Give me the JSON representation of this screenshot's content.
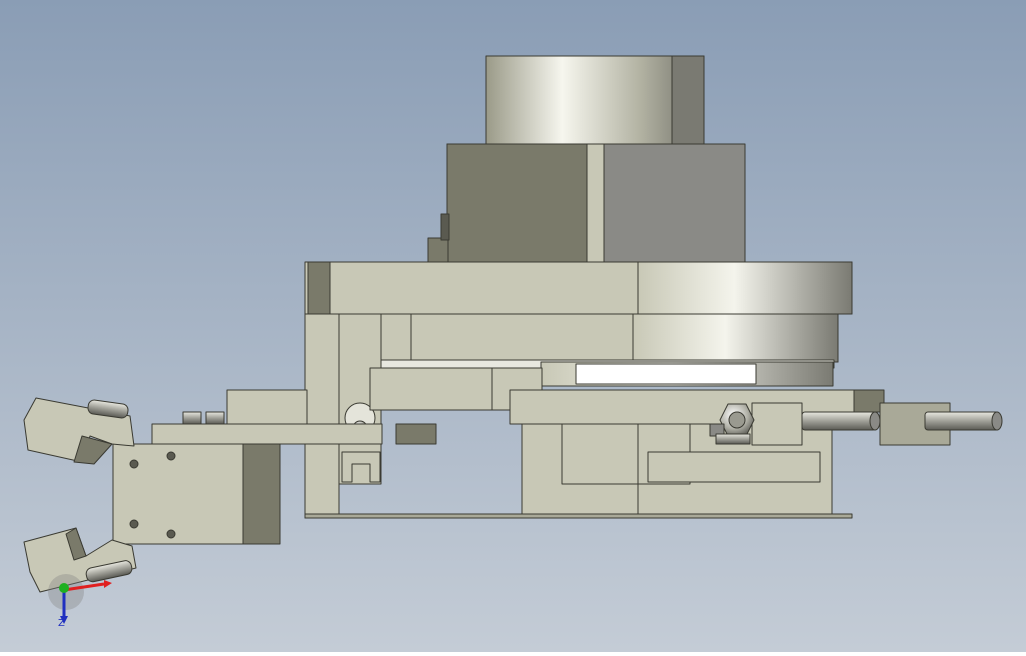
{
  "viewport": {
    "background_top": "#8a9db5",
    "background_bottom": "#c4ccd6"
  },
  "palette": {
    "plate": "#c8c8b6",
    "plate_dark": "#a9a998",
    "edge": "#3a3a32",
    "motor_dark": "#7a7a6a",
    "motor_mid": "#8a8a86",
    "shadow": "#5a5a50",
    "metal_light": "#f4f4ec",
    "metal_mid": "#bdbdb0",
    "metal_dark": "#6e6e66"
  },
  "icons": {
    "triad": "coordinate-triad-icon"
  },
  "triad": {
    "axis_x_color": "#e02020",
    "axis_y_color": "#20b020",
    "axis_z_color": "#2030c0",
    "z_label": "Z"
  }
}
